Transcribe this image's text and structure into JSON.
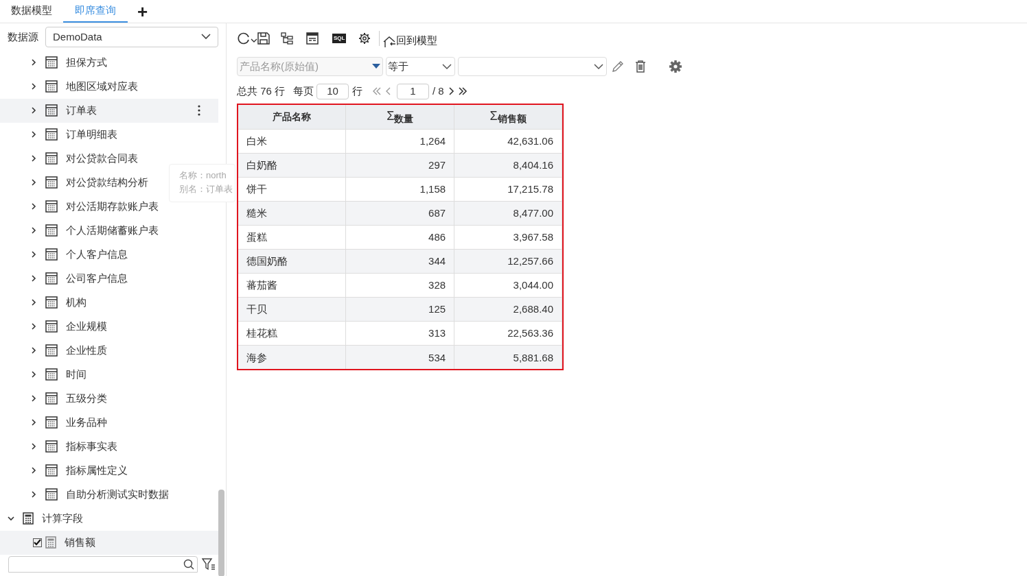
{
  "tabs": [
    {
      "label": "数据模型",
      "selected": false
    },
    {
      "label": "即席查询",
      "selected": true
    }
  ],
  "add_tab": "+",
  "datasource": {
    "label": "数据源",
    "value": "DemoData"
  },
  "tree": [
    {
      "label": "担保方式",
      "kind": "table",
      "selected": false
    },
    {
      "label": "地图区域对应表",
      "kind": "table",
      "selected": false
    },
    {
      "label": "订单表",
      "kind": "table",
      "selected": true
    },
    {
      "label": "订单明细表",
      "kind": "table",
      "selected": false
    },
    {
      "label": "对公贷款合同表",
      "kind": "table",
      "selected": false
    },
    {
      "label": "对公贷款结构分析",
      "kind": "table",
      "selected": false
    },
    {
      "label": "对公活期存款账户表",
      "kind": "table",
      "selected": false
    },
    {
      "label": "个人活期储蓄账户表",
      "kind": "table",
      "selected": false
    },
    {
      "label": "个人客户信息",
      "kind": "table",
      "selected": false
    },
    {
      "label": "公司客户信息",
      "kind": "table",
      "selected": false
    },
    {
      "label": "机构",
      "kind": "table",
      "selected": false
    },
    {
      "label": "企业规模",
      "kind": "table",
      "selected": false
    },
    {
      "label": "企业性质",
      "kind": "table",
      "selected": false
    },
    {
      "label": "时间",
      "kind": "table",
      "selected": false
    },
    {
      "label": "五级分类",
      "kind": "table",
      "selected": false
    },
    {
      "label": "业务品种",
      "kind": "table",
      "selected": false
    },
    {
      "label": "指标事实表",
      "kind": "table",
      "selected": false
    },
    {
      "label": "指标属性定义",
      "kind": "table",
      "selected": false
    },
    {
      "label": "自助分析测试实时数据",
      "kind": "table",
      "selected": false
    },
    {
      "label": "计算字段",
      "kind": "folder",
      "selected": false,
      "expanded": true,
      "children": [
        {
          "label": "销售额",
          "kind": "field",
          "selected": true,
          "checked": true
        }
      ]
    }
  ],
  "tooltip": {
    "lines": [
      "名称：north",
      "别名：订单表"
    ]
  },
  "toolbar": {
    "sql_label": "SQL",
    "back_button": "回到模型"
  },
  "filter": {
    "field": "产品名称(原始值)",
    "operator": "等于"
  },
  "pagination": {
    "total": "总共 76 行",
    "per_page_label": "每页",
    "per_page": "10",
    "rows_label": "行",
    "page": "1",
    "pages": "/ 8"
  },
  "table": {
    "columns": [
      {
        "label": "产品名称"
      },
      {
        "label": "数量",
        "sum_sign": "Σ"
      },
      {
        "label": "销售额",
        "sum_sign": "Σ"
      }
    ],
    "rows": [
      [
        "白米",
        "1,264",
        "42,631.06"
      ],
      [
        "白奶酪",
        "297",
        "8,404.16"
      ],
      [
        "饼干",
        "1,158",
        "17,215.78"
      ],
      [
        "糙米",
        "687",
        "8,477.00"
      ],
      [
        "蛋糕",
        "486",
        "3,967.58"
      ],
      [
        "德国奶酪",
        "344",
        "12,257.66"
      ],
      [
        "蕃茄酱",
        "328",
        "3,044.00"
      ],
      [
        "干贝",
        "125",
        "2,688.40"
      ],
      [
        "桂花糕",
        "313",
        "22,563.36"
      ],
      [
        "海参",
        "534",
        "5,881.68"
      ]
    ]
  }
}
